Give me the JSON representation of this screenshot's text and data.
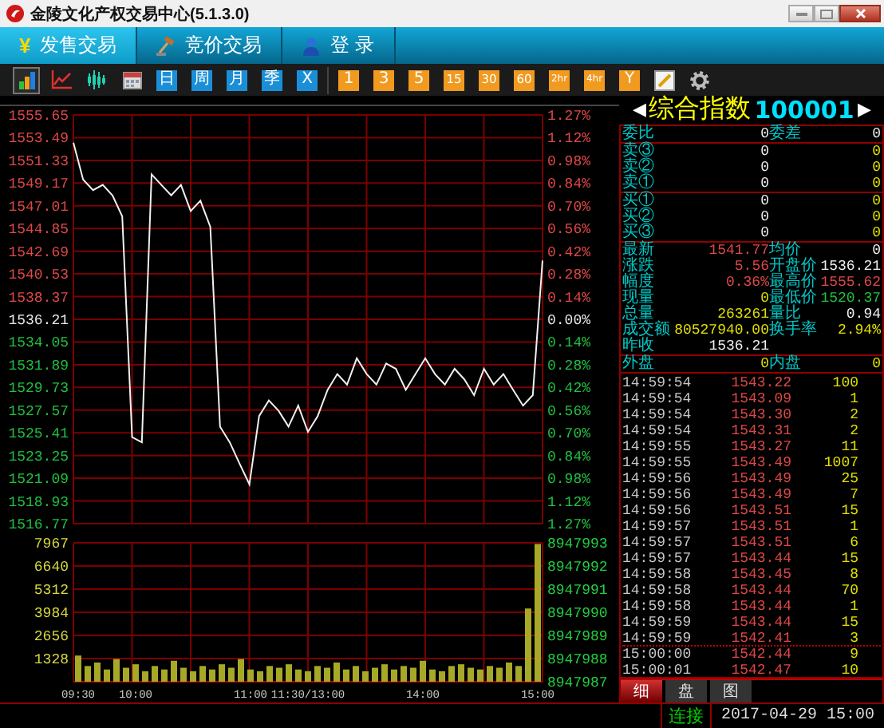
{
  "window": {
    "title": "金陵文化产权交易中心(5.1.3.0)"
  },
  "tabs": [
    {
      "glyph": "¥",
      "label": "发售交易",
      "selected": true
    },
    {
      "label": "竞价交易",
      "selected": false
    },
    {
      "label": "登 录",
      "selected": false
    }
  ],
  "toolbar": {
    "groups": [
      [
        {
          "kind": "bars",
          "selected": true
        },
        {
          "kind": "line",
          "selected": false
        },
        {
          "kind": "wave",
          "selected": false
        },
        {
          "kind": "calendar",
          "selected": false
        },
        {
          "kind": "tile",
          "label": "日",
          "color": "#1a8fd8",
          "selected": false
        },
        {
          "kind": "tile",
          "label": "周",
          "color": "#1a8fd8",
          "selected": false
        },
        {
          "kind": "tile",
          "label": "月",
          "color": "#1a8fd8",
          "selected": false
        },
        {
          "kind": "tile",
          "label": "季",
          "color": "#1a8fd8",
          "selected": false
        },
        {
          "kind": "tile",
          "label": "X",
          "color": "#1a8fd8",
          "selected": false
        }
      ],
      [
        {
          "kind": "tile",
          "label": "1",
          "color": "#f09a20",
          "selected": false
        },
        {
          "kind": "tile",
          "label": "3",
          "color": "#f09a20",
          "selected": false
        },
        {
          "kind": "tile",
          "label": "5",
          "color": "#f09a20",
          "selected": false
        },
        {
          "kind": "tile",
          "label": "15",
          "color": "#f09a20",
          "selected": false
        },
        {
          "kind": "tile",
          "label": "30",
          "color": "#f09a20",
          "selected": false
        },
        {
          "kind": "tile",
          "label": "60",
          "color": "#f09a20",
          "selected": false
        },
        {
          "kind": "tile",
          "label": "2hr",
          "color": "#f09a20",
          "selected": false
        },
        {
          "kind": "tile",
          "label": "4hr",
          "color": "#f09a20",
          "selected": false
        },
        {
          "kind": "tile",
          "label": "Y",
          "color": "#f09a20",
          "selected": false
        },
        {
          "kind": "pencil",
          "selected": false
        },
        {
          "kind": "gear",
          "selected": false
        }
      ]
    ]
  },
  "chart": {
    "price": {
      "chart_data": {
        "type": "line",
        "grid": true,
        "ylim": [
          1516.77,
          1555.65
        ],
        "categories": [
          null,
          null,
          null,
          null,
          null,
          null,
          null,
          null,
          null,
          null,
          null,
          null,
          null,
          null,
          null,
          null,
          null,
          null,
          null,
          null,
          null,
          null,
          null,
          null,
          null,
          null,
          null,
          null,
          null,
          null,
          null,
          null,
          null,
          null,
          null,
          null,
          null,
          null,
          null,
          null,
          null,
          null,
          null,
          null,
          null,
          null,
          null,
          null,
          null
        ],
        "series": [
          {
            "color": "#f0f0f0",
            "values": [
              1553.0,
              1549.5,
              1548.5,
              1549.0,
              1548.0,
              1546.0,
              1525.0,
              1524.5,
              1550.0,
              1549.0,
              1548.0,
              1549.0,
              1546.5,
              1547.5,
              1545.0,
              1526.0,
              1524.5,
              1522.5,
              1520.5,
              1527.0,
              1528.5,
              1527.5,
              1526.0,
              1528.0,
              1525.5,
              1527.0,
              1529.5,
              1531.0,
              1530.0,
              1532.5,
              1531.0,
              1530.0,
              1532.0,
              1531.5,
              1529.5,
              1531.0,
              1532.5,
              1531.0,
              1530.0,
              1531.5,
              1530.5,
              1529.0,
              1531.5,
              1530.0,
              1531.0,
              1529.5,
              1528.0,
              1529.0,
              1541.8
            ]
          }
        ],
        "yticks": [
          {
            "value": 1555.65,
            "label": "1555.65"
          },
          {
            "value": 1553.49,
            "label": "1553.49"
          },
          {
            "value": 1551.33,
            "label": "1551.33"
          },
          {
            "value": 1549.17,
            "label": "1549.17"
          },
          {
            "value": 1547.01,
            "label": "1547.01"
          },
          {
            "value": 1544.85,
            "label": "1544.85"
          },
          {
            "value": 1542.69,
            "label": "1542.69"
          },
          {
            "value": 1540.53,
            "label": "1540.53"
          },
          {
            "value": 1538.37,
            "label": "1538.37"
          },
          {
            "value": 1536.21,
            "label": "1536.21"
          },
          {
            "value": 1534.05,
            "label": "1534.05"
          },
          {
            "value": 1531.89,
            "label": "1531.89"
          },
          {
            "value": 1529.73,
            "label": "1529.73"
          },
          {
            "value": 1527.57,
            "label": "1527.57"
          },
          {
            "value": 1525.41,
            "label": "1525.41"
          },
          {
            "value": 1523.25,
            "label": "1523.25"
          },
          {
            "value": 1521.09,
            "label": "1521.09"
          },
          {
            "value": 1518.93,
            "label": "1518.93"
          },
          {
            "value": 1516.77,
            "label": "1516.77"
          }
        ]
      },
      "percent_labels": [
        "1.27%",
        "1.12%",
        "0.98%",
        "0.84%",
        "0.70%",
        "0.56%",
        "0.42%",
        "0.28%",
        "0.14%",
        "0.00%",
        "0.14%",
        "0.28%",
        "0.42%",
        "0.56%",
        "0.70%",
        "0.84%",
        "0.98%",
        "1.12%",
        "1.27%"
      ]
    },
    "volume": {
      "chart_data": {
        "type": "bar",
        "grid": true,
        "ylim": [
          0,
          7967
        ],
        "categories": [
          "09:30",
          null,
          null,
          null,
          null,
          null,
          "10:00",
          null,
          null,
          null,
          null,
          null,
          null,
          null,
          null,
          null,
          null,
          null,
          "11:00",
          null,
          null,
          null,
          null,
          null,
          "11:30/13:00",
          null,
          null,
          null,
          null,
          null,
          null,
          null,
          null,
          null,
          null,
          null,
          "14:00",
          null,
          null,
          null,
          null,
          null,
          null,
          null,
          null,
          null,
          null,
          null,
          "15:00"
        ],
        "series": [
          {
            "color": "#a8a828",
            "values": [
              1500,
              900,
              1100,
              700,
              1300,
              800,
              1000,
              600,
              900,
              700,
              1200,
              800,
              600,
              900,
              700,
              1000,
              800,
              1300,
              700,
              600,
              900,
              800,
              1000,
              700,
              600,
              900,
              800,
              1100,
              700,
              900,
              600,
              800,
              1000,
              700,
              900,
              800,
              1200,
              700,
              600,
              900,
              1000,
              800,
              700,
              900,
              800,
              1100,
              900,
              4200,
              7900
            ]
          }
        ],
        "yticks": [
          {
            "value": 7967,
            "label": "7967"
          },
          {
            "value": 6640,
            "label": "6640"
          },
          {
            "value": 5312,
            "label": "5312"
          },
          {
            "value": 3984,
            "label": "3984"
          },
          {
            "value": 2656,
            "label": "2656"
          },
          {
            "value": 1328,
            "label": "1328"
          }
        ]
      },
      "right_labels": [
        "8947993",
        "8947992",
        "8947991",
        "8947990",
        "8947989",
        "8947988",
        "8947987"
      ]
    }
  },
  "quote": {
    "prev_arrow": "◀",
    "name": "综合指数",
    "code": "100001",
    "next_arrow": "▶",
    "ratio": [
      {
        "label": "委比",
        "value": "0"
      },
      {
        "label": "委差",
        "value": "0"
      }
    ],
    "asks": [
      {
        "label": "卖③",
        "price": "0",
        "volume": "0"
      },
      {
        "label": "卖②",
        "price": "0",
        "volume": "0"
      },
      {
        "label": "卖①",
        "price": "0",
        "volume": "0"
      }
    ],
    "bids": [
      {
        "label": "买①",
        "price": "0",
        "volume": "0"
      },
      {
        "label": "买②",
        "price": "0",
        "volume": "0"
      },
      {
        "label": "买③",
        "price": "0",
        "volume": "0"
      }
    ],
    "stats": [
      {
        "label": "最新",
        "value": "1541.77",
        "color": "#e04848"
      },
      {
        "label": "均价",
        "value": "0",
        "color": "#f0f0f0"
      },
      {
        "label": "涨跌",
        "value": "5.56",
        "color": "#e04848"
      },
      {
        "label": "开盘价",
        "value": "1536.21",
        "color": "#f0f0f0"
      },
      {
        "label": "幅度",
        "value": "0.36%",
        "color": "#e04848"
      },
      {
        "label": "最高价",
        "value": "1555.62",
        "color": "#e04848"
      },
      {
        "label": "现量",
        "value": "0",
        "color": "#e0e000"
      },
      {
        "label": "最低价",
        "value": "1520.37",
        "color": "#20c040"
      },
      {
        "label": "总量",
        "value": "263261",
        "color": "#e0e000"
      },
      {
        "label": "量比",
        "value": "0.94",
        "color": "#f0f0f0"
      },
      {
        "label": "成交额",
        "value": "80527940.00",
        "color": "#e0e000"
      },
      {
        "label": "换手率",
        "value": "2.94%",
        "color": "#e0e000"
      },
      {
        "label": "昨收",
        "value": "1536.21",
        "color": "#f0f0f0"
      }
    ],
    "outer": [
      {
        "label": "外盘",
        "value": "0"
      },
      {
        "label": "内盘",
        "value": "0"
      }
    ],
    "trades": [
      {
        "time": "14:59:54",
        "price": "1543.22",
        "volume": "100",
        "divider_above": false
      },
      {
        "time": "14:59:54",
        "price": "1543.09",
        "volume": "1",
        "divider_above": false
      },
      {
        "time": "14:59:54",
        "price": "1543.30",
        "volume": "2",
        "divider_above": false
      },
      {
        "time": "14:59:54",
        "price": "1543.31",
        "volume": "2",
        "divider_above": false
      },
      {
        "time": "14:59:55",
        "price": "1543.27",
        "volume": "11",
        "divider_above": false
      },
      {
        "time": "14:59:55",
        "price": "1543.49",
        "volume": "1007",
        "divider_above": false
      },
      {
        "time": "14:59:56",
        "price": "1543.49",
        "volume": "25",
        "divider_above": false
      },
      {
        "time": "14:59:56",
        "price": "1543.49",
        "volume": "7",
        "divider_above": false
      },
      {
        "time": "14:59:56",
        "price": "1543.51",
        "volume": "15",
        "divider_above": false
      },
      {
        "time": "14:59:57",
        "price": "1543.51",
        "volume": "1",
        "divider_above": false
      },
      {
        "time": "14:59:57",
        "price": "1543.51",
        "volume": "6",
        "divider_above": false
      },
      {
        "time": "14:59:57",
        "price": "1543.44",
        "volume": "15",
        "divider_above": false
      },
      {
        "time": "14:59:58",
        "price": "1543.45",
        "volume": "8",
        "divider_above": false
      },
      {
        "time": "14:59:58",
        "price": "1543.44",
        "volume": "70",
        "divider_above": false
      },
      {
        "time": "14:59:58",
        "price": "1543.44",
        "volume": "1",
        "divider_above": false
      },
      {
        "time": "14:59:59",
        "price": "1543.44",
        "volume": "15",
        "divider_above": false
      },
      {
        "time": "14:59:59",
        "price": "1542.41",
        "volume": "3",
        "divider_above": false
      },
      {
        "time": "15:00:00",
        "price": "1542.44",
        "volume": "9",
        "divider_above": true
      },
      {
        "time": "15:00:01",
        "price": "1542.47",
        "volume": "10",
        "divider_above": false
      }
    ],
    "tabs": [
      {
        "label": "细",
        "selected": true
      },
      {
        "label": "盘",
        "selected": false
      },
      {
        "label": "图",
        "selected": false
      }
    ]
  },
  "status_bar": {
    "connection": "连接",
    "datetime": "2017-04-29 15:00"
  }
}
